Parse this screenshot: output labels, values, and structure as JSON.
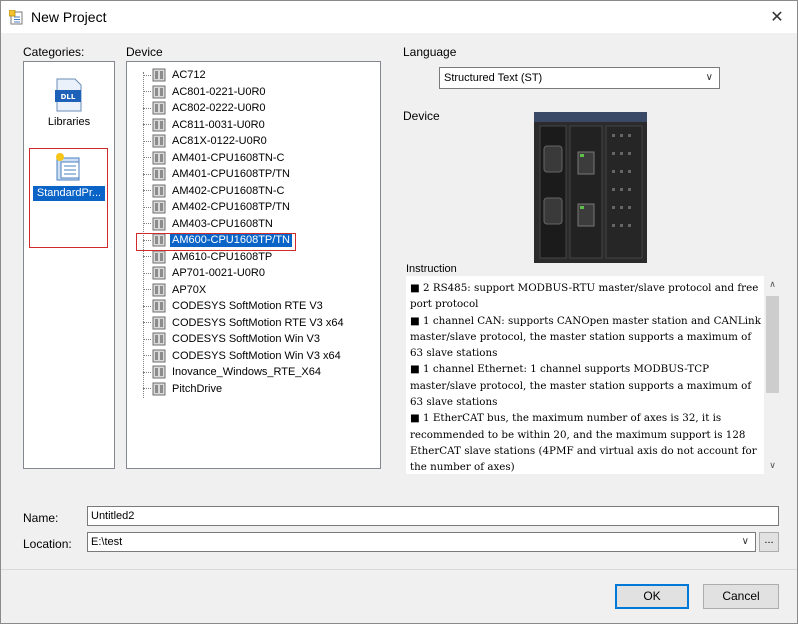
{
  "window": {
    "title": "New Project",
    "close_glyph": "✕"
  },
  "labels": {
    "categories": "Categories:",
    "device": "Device",
    "language": "Language",
    "device_preview": "Device",
    "instruction": "Instruction",
    "name": "Name:",
    "location": "Location:"
  },
  "categories": {
    "items": [
      {
        "label": "Libraries",
        "icon": "dll-icon",
        "icon_text": "DLL",
        "selected": false
      },
      {
        "label": "StandardPr...",
        "icon": "standard-project-icon",
        "selected": true
      }
    ]
  },
  "devices": {
    "items": [
      "AC712",
      "AC801-0221-U0R0",
      "AC802-0222-U0R0",
      "AC811-0031-U0R0",
      "AC81X-0122-U0R0",
      "AM401-CPU1608TN-C",
      "AM401-CPU1608TP/TN",
      "AM402-CPU1608TN-C",
      "AM402-CPU1608TP/TN",
      "AM403-CPU1608TN",
      "AM600-CPU1608TP/TN",
      "AM610-CPU1608TP",
      "AP701-0021-U0R0",
      "AP70X",
      "CODESYS SoftMotion RTE V3",
      "CODESYS SoftMotion RTE V3 x64",
      "CODESYS SoftMotion Win V3",
      "CODESYS SoftMotion Win V3 x64",
      "Inovance_Windows_RTE_X64",
      "PitchDrive"
    ],
    "selected_index": 10
  },
  "language": {
    "value": "Structured Text (ST)"
  },
  "instruction": {
    "lines": [
      "■ 2 RS485: support MODBUS-RTU master/slave protocol and free port protocol",
      "■ 1 channel CAN: supports CANOpen master station and CANLink master/slave protocol, the master station supports a maximum of 63 slave stations",
      "■ 1 channel Ethernet: 1 channel supports MODBUS-TCP master/slave protocol, the master station supports a maximum of 63 slave stations",
      "■ 1 EtherCAT bus, the maximum number of axes is 32, it is recommended to be within 20, and the maximum support is 128 EtherCAT slave stations (4PMF and virtual axis do not account for the number of axes)"
    ]
  },
  "form": {
    "name_value": "Untitled2",
    "location_value": "E:\\test",
    "browse_label": "..."
  },
  "buttons": {
    "ok": "OK",
    "cancel": "Cancel"
  },
  "colors": {
    "selection": "#0a64c8",
    "highlight_frame": "#d12a2a",
    "focus_border": "#0078d7"
  }
}
